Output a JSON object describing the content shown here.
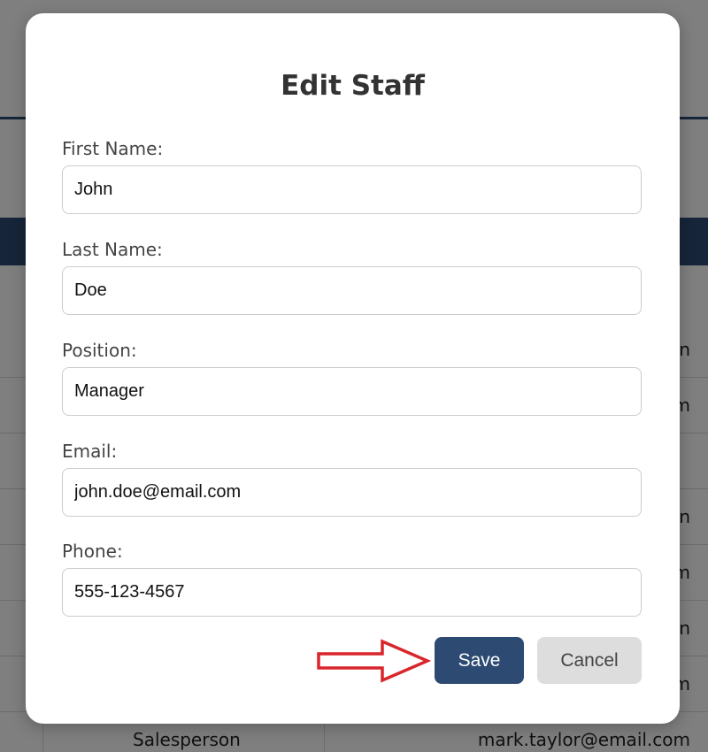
{
  "background": {
    "rows": [
      {
        "position": "",
        "email": "n"
      },
      {
        "position": "",
        "email": "m"
      },
      {
        "position": "",
        "email": ""
      },
      {
        "position": "",
        "email": "n"
      },
      {
        "position": "",
        "email": "om"
      },
      {
        "position": "",
        "email": "n"
      },
      {
        "position": "",
        "email": "m"
      },
      {
        "position": "Salesperson",
        "email": "mark.taylor@email.com"
      }
    ]
  },
  "modal": {
    "title": "Edit Staff",
    "fields": [
      {
        "label": "First Name:",
        "value": "John"
      },
      {
        "label": "Last Name:",
        "value": "Doe"
      },
      {
        "label": "Position:",
        "value": "Manager"
      },
      {
        "label": "Email:",
        "value": "john.doe@email.com"
      },
      {
        "label": "Phone:",
        "value": "555-123-4567"
      }
    ],
    "save_label": "Save",
    "cancel_label": "Cancel"
  },
  "colors": {
    "primary": "#2c4a72",
    "cancel_bg": "#dddddd",
    "arrow": "#d9262c"
  },
  "icons": {
    "annotation": "right-arrow-icon"
  }
}
